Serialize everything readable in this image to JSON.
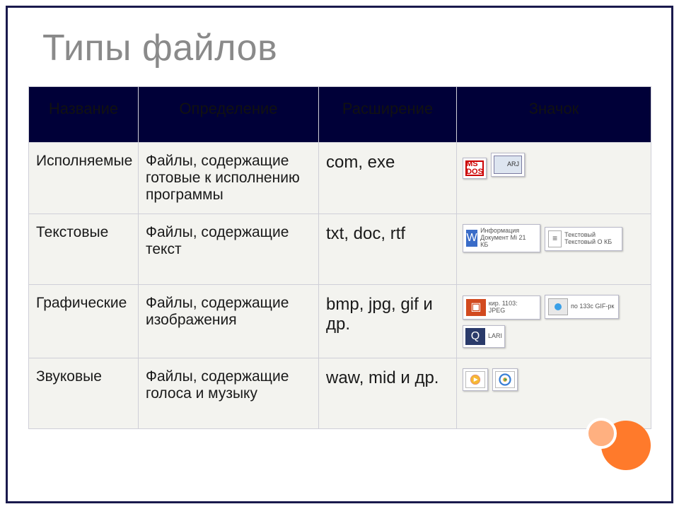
{
  "title": "Типы файлов",
  "headers": {
    "c1": "Название",
    "c2": "Определение",
    "c3": "Расширение",
    "c4": "Значок"
  },
  "rows": [
    {
      "name": "Исполняемые",
      "definition": "Файлы, содержащие готовые к исполнению программы",
      "extension": "com, exe",
      "icons": [
        "msdos",
        "arj"
      ],
      "icon_text": {
        "msdos": "MS\nDOS",
        "arj": "ARJ"
      }
    },
    {
      "name": "Текстовые",
      "definition": "Файлы, содержащие текст",
      "extension": "txt, doc, rtf",
      "icons": [
        "word",
        "txt"
      ],
      "icon_text": {
        "word": "Информация\nДокумент Mi\n21 КБ",
        "txt": "Текстовый\nТекстовый\nО КБ"
      }
    },
    {
      "name": "Графические",
      "definition": "Файлы, содержащие изображения",
      "extension": "bmp, jpg, gif и др.",
      "icons": [
        "ppt",
        "qt",
        "gif"
      ],
      "icon_text": {
        "ppt": "кир.\n1103:\nJPEG",
        "qt": "LARI",
        "gif": "по\n133с\nGIF-рк"
      }
    },
    {
      "name": "Звуковые",
      "definition": "Файлы, содержащие голоса и музыку",
      "extension": "waw, mid и др.",
      "icons": [
        "wav",
        "wmp"
      ],
      "icon_text": {
        "wav": "",
        "wmp": ""
      }
    }
  ]
}
